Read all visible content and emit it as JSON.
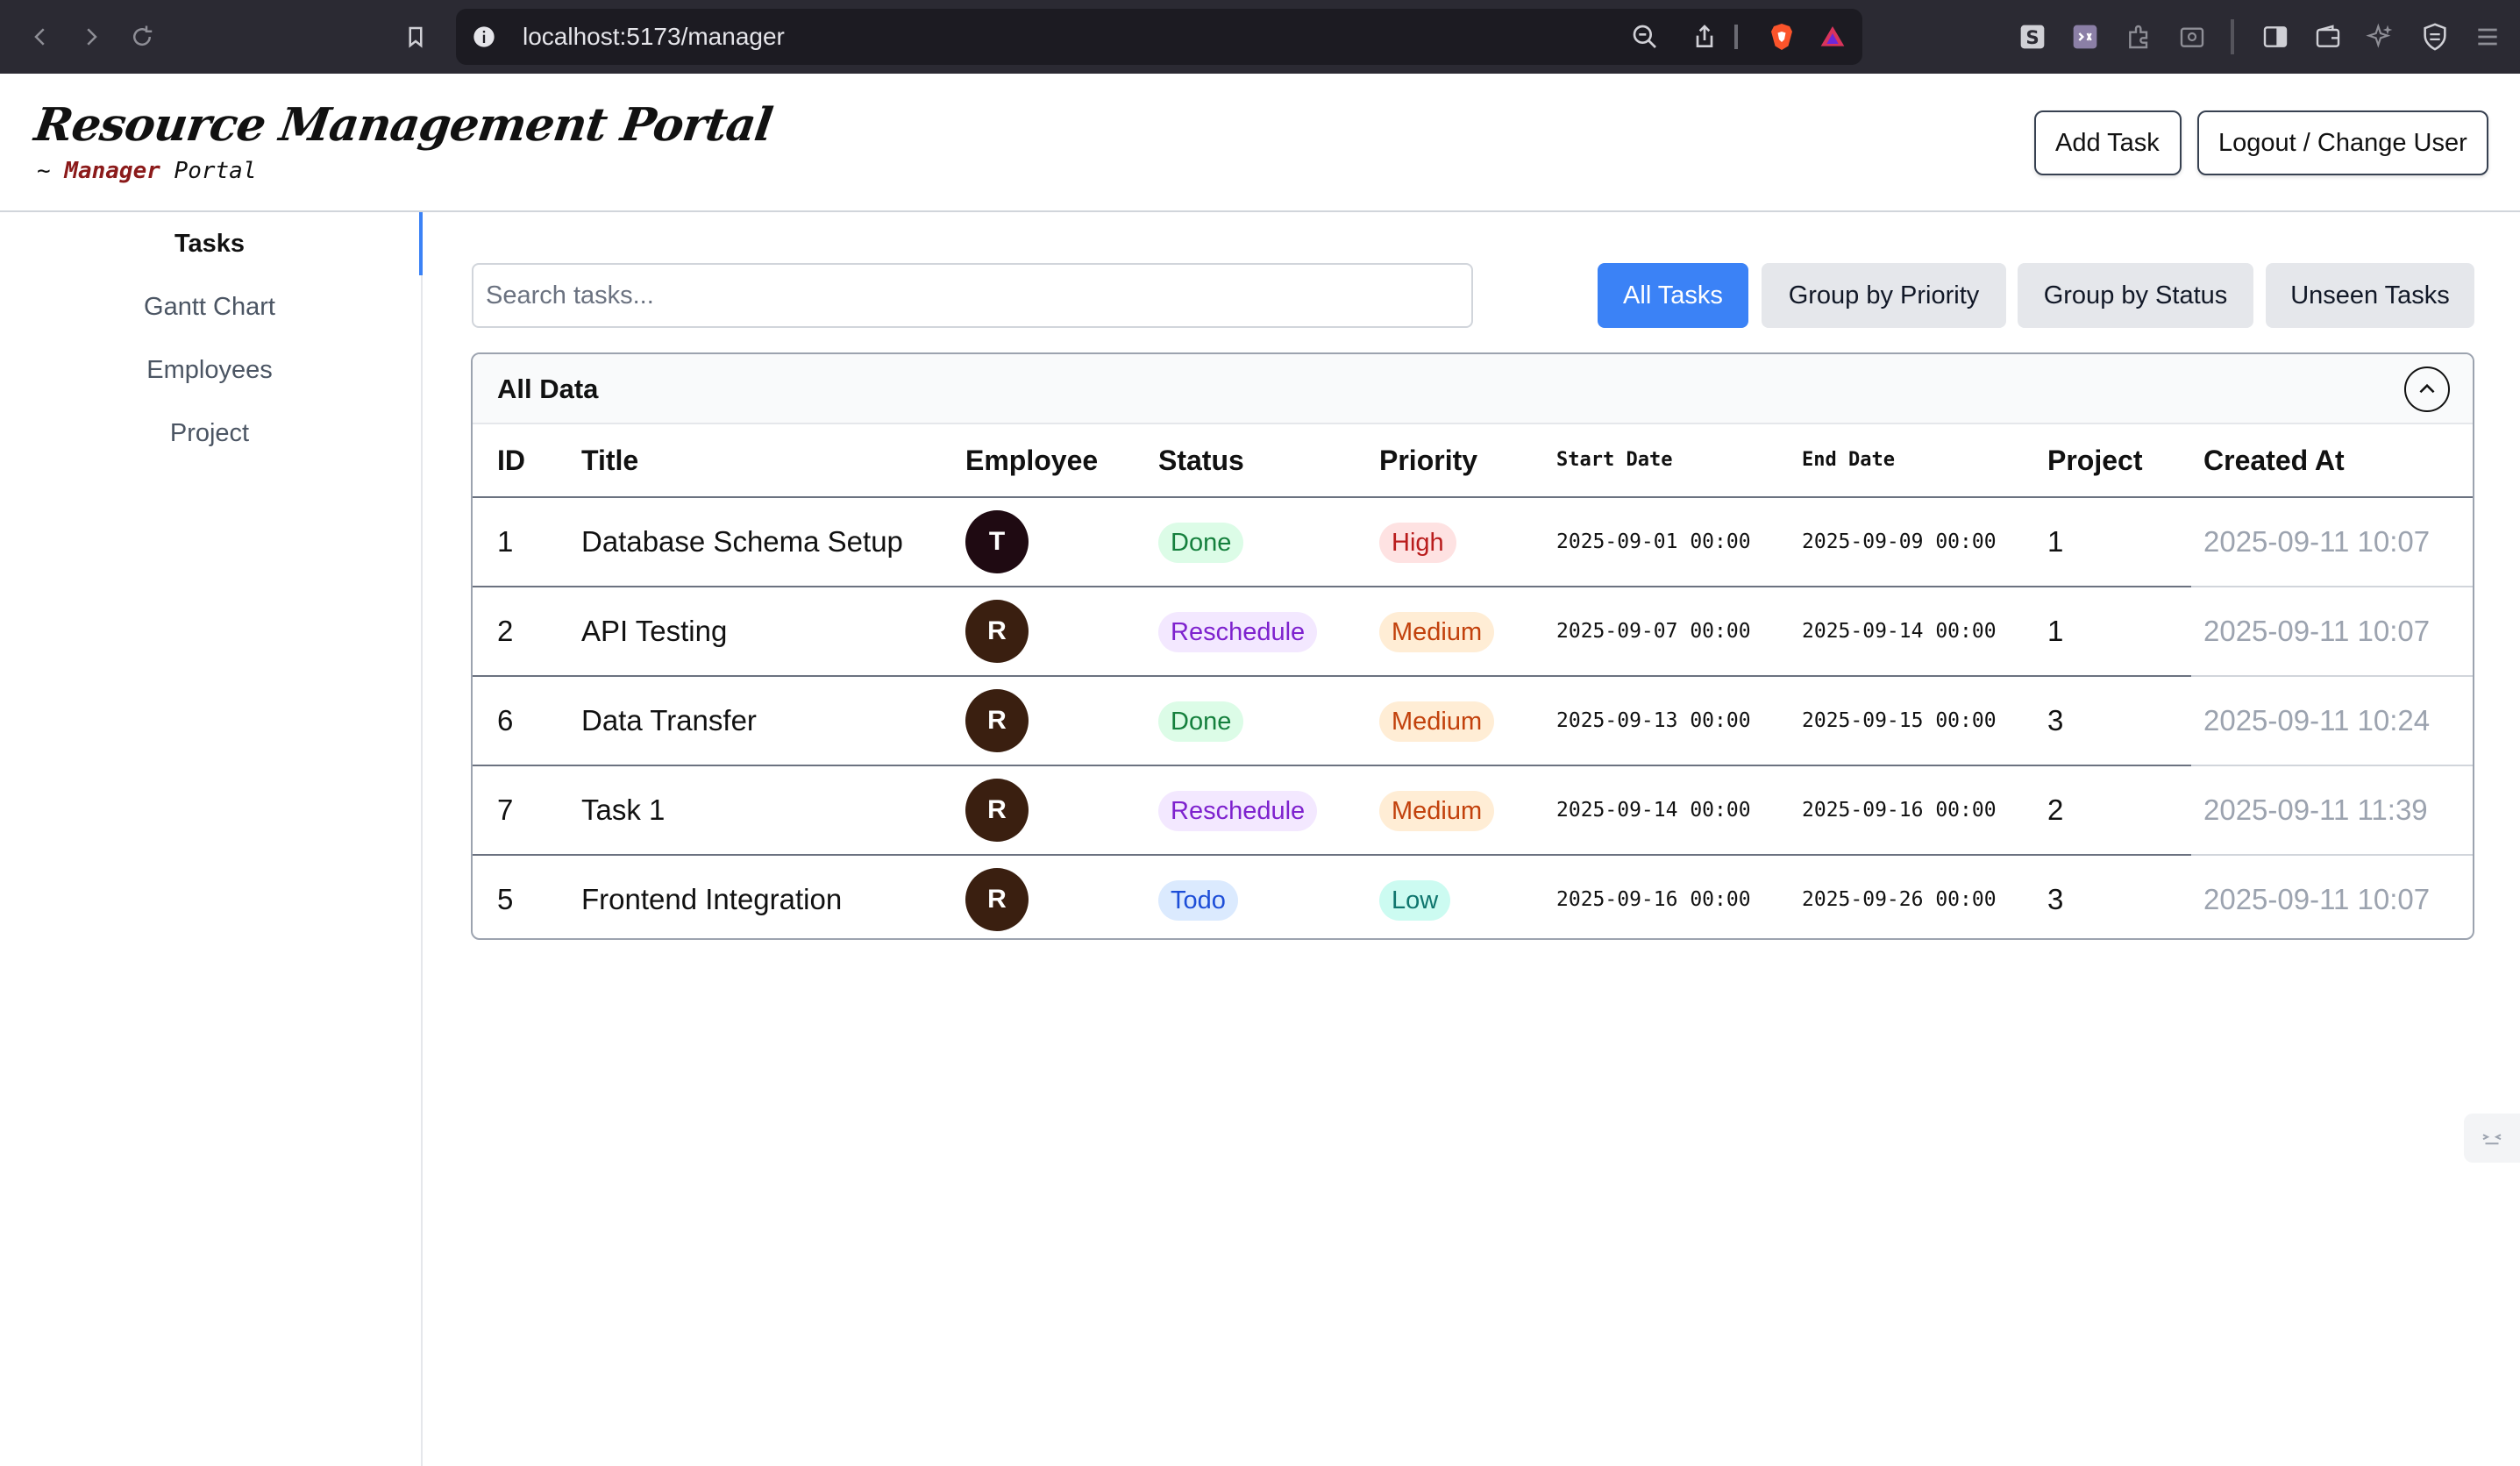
{
  "browser": {
    "url": "localhost:5173/manager"
  },
  "header": {
    "title": "Resource Management Portal",
    "subtitle_prefix": "~",
    "subtitle_role": "Manager",
    "subtitle_suffix": "Portal",
    "add_task_label": "Add Task",
    "logout_label": "Logout / Change User"
  },
  "sidebar": {
    "items": [
      {
        "label": "Tasks",
        "active": true
      },
      {
        "label": "Gantt Chart"
      },
      {
        "label": "Employees"
      },
      {
        "label": "Project"
      }
    ]
  },
  "search": {
    "placeholder": "Search tasks...",
    "value": ""
  },
  "filters": [
    {
      "label": "All Tasks",
      "active": true
    },
    {
      "label": "Group by Priority"
    },
    {
      "label": "Group by Status"
    },
    {
      "label": "Unseen Tasks"
    }
  ],
  "table": {
    "title": "All Data",
    "columns": [
      "ID",
      "Title",
      "Employee",
      "Status",
      "Priority",
      "Start Date",
      "End Date",
      "Project",
      "Created At"
    ],
    "rows": [
      {
        "id": "1",
        "title": "Database Schema Setup",
        "employee": "T",
        "employee_color": "#1f0a12",
        "status": "Done",
        "priority": "High",
        "start": "2025-09-01 00:00",
        "end": "2025-09-09 00:00",
        "project": "1",
        "created": "2025-09-11 10:07"
      },
      {
        "id": "2",
        "title": "API Testing",
        "employee": "R",
        "employee_color": "#3a1f10",
        "status": "Reschedule",
        "priority": "Medium",
        "start": "2025-09-07 00:00",
        "end": "2025-09-14 00:00",
        "project": "1",
        "created": "2025-09-11 10:07"
      },
      {
        "id": "6",
        "title": "Data Transfer",
        "employee": "R",
        "employee_color": "#3a1f10",
        "status": "Done",
        "priority": "Medium",
        "start": "2025-09-13 00:00",
        "end": "2025-09-15 00:00",
        "project": "3",
        "created": "2025-09-11 10:24"
      },
      {
        "id": "7",
        "title": "Task 1",
        "employee": "R",
        "employee_color": "#3a1f10",
        "status": "Reschedule",
        "priority": "Medium",
        "start": "2025-09-14 00:00",
        "end": "2025-09-16 00:00",
        "project": "2",
        "created": "2025-09-11 11:39"
      },
      {
        "id": "5",
        "title": "Frontend Integration",
        "employee": "R",
        "employee_color": "#3a1f10",
        "status": "Todo",
        "priority": "Low",
        "start": "2025-09-16 00:00",
        "end": "2025-09-26 00:00",
        "project": "3",
        "created": "2025-09-11 10:07"
      }
    ]
  },
  "colors": {
    "accent": "#3b82f6",
    "status": {
      "Done": {
        "bg": "#dcfce7",
        "fg": "#15803d"
      },
      "Reschedule": {
        "bg": "#f3e8ff",
        "fg": "#7e22ce"
      },
      "Todo": {
        "bg": "#dbeafe",
        "fg": "#1d4ed8"
      }
    },
    "priority": {
      "High": {
        "bg": "#fee2e2",
        "fg": "#b91c1c"
      },
      "Medium": {
        "bg": "#ffedd5",
        "fg": "#c2410c"
      },
      "Low": {
        "bg": "#ccfbf1",
        "fg": "#0f766e"
      }
    }
  },
  "icons": {
    "browser": [
      "back-icon",
      "forward-icon",
      "reload-icon",
      "bookmark-icon",
      "site-info-icon",
      "zoom-icon",
      "share-icon",
      "brave-shield-icon",
      "rewards-icon",
      "extension-s-icon",
      "extension-game-icon",
      "extensions-puzzle-icon",
      "find-icon",
      "sidebar-toggle-icon",
      "wallet-icon",
      "leo-ai-icon",
      "vpn-shield-icon",
      "menu-icon"
    ],
    "page": [
      "collapse-chevron-icon",
      "devtools-icon"
    ]
  }
}
